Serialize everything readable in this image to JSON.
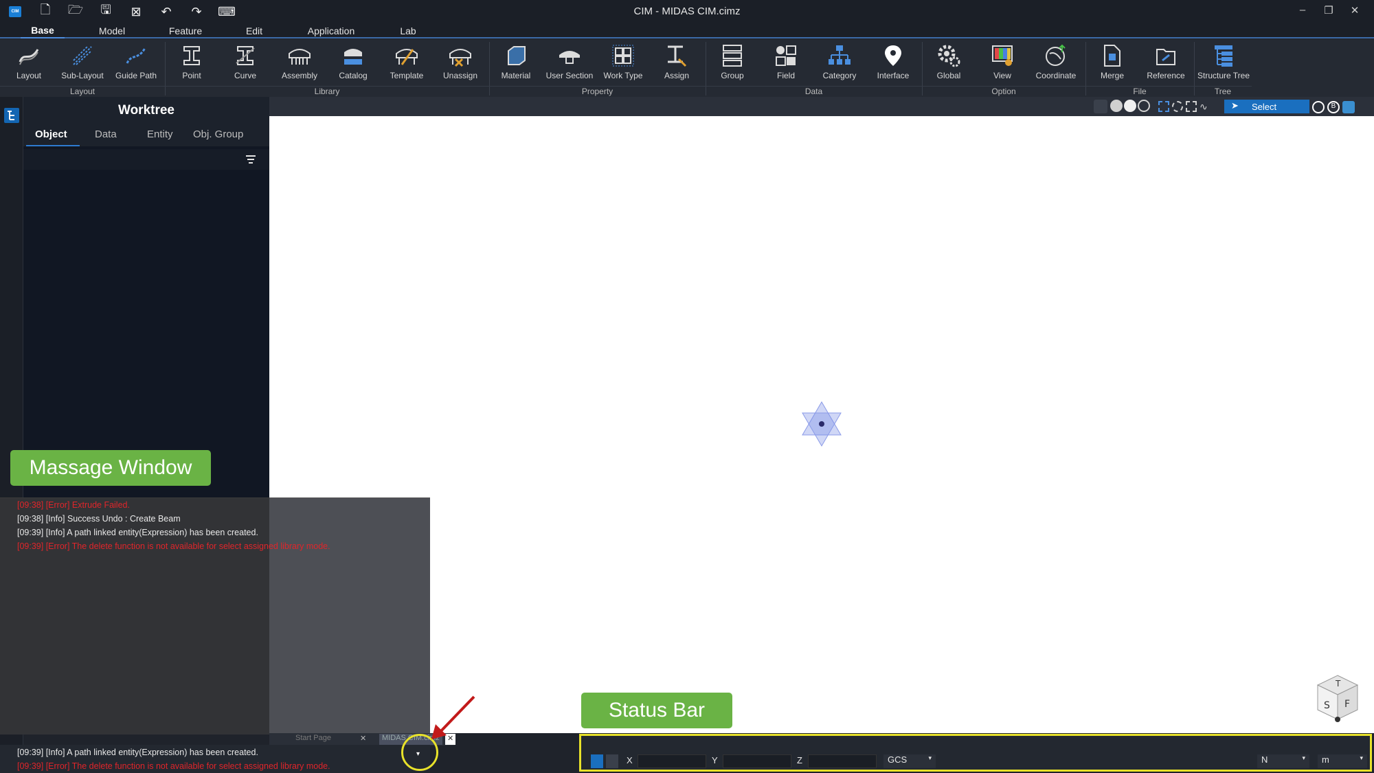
{
  "window": {
    "title": "CIM - MIDAS CIM.cimz",
    "logo_text": "CIM"
  },
  "menu": {
    "tabs": [
      "Base",
      "Model",
      "Feature",
      "Edit",
      "Application",
      "Lab"
    ],
    "active": "Base"
  },
  "ribbon": {
    "buttons": [
      "Layout",
      "Sub-Layout",
      "Guide Path",
      "Point",
      "Curve",
      "Assembly",
      "Catalog",
      "Template",
      "Unassign",
      "Material",
      "User Section",
      "Work Type",
      "Assign",
      "Group",
      "Field",
      "Category",
      "Interface",
      "Global",
      "View",
      "Coordinate",
      "Merge",
      "Reference",
      "Structure Tree"
    ],
    "groups": [
      "Layout",
      "Library",
      "Property",
      "Data",
      "Option",
      "File",
      "Tree"
    ]
  },
  "worktree": {
    "title": "Worktree",
    "tabs": [
      "Object",
      "Data",
      "Entity",
      "Obj. Group"
    ],
    "active_tab": "Object"
  },
  "viewbar": {
    "select_label": "Select"
  },
  "messages": [
    {
      "text": "[09:38] [Error] Extrude Failed.",
      "type": "err"
    },
    {
      "text": "[09:38] [Info] Success Undo : Create Beam",
      "type": "info"
    },
    {
      "text": "[09:39] [Info] A path linked entity(Expression) has been created.",
      "type": "info"
    },
    {
      "text": "[09:39] [Error] The delete function is not available for select assigned library mode.",
      "type": "err"
    }
  ],
  "bottom_messages": [
    {
      "text": "[09:39] [Info] A path linked entity(Expression) has been created.",
      "type": "info"
    },
    {
      "text": "[09:39] [Error] The delete function is not available for select assigned library mode.",
      "type": "err"
    }
  ],
  "doc_tabs": [
    "Start Page",
    "MIDAS CIM.cimz"
  ],
  "statusbar": {
    "x_label": "X",
    "y_label": "Y",
    "z_label": "Z",
    "coord_system": "GCS",
    "force_unit": "N",
    "length_unit": "m"
  },
  "callouts": {
    "message_window": "Massage Window",
    "status_bar": "Status Bar"
  },
  "view_cube": {
    "faces": [
      "T",
      "S",
      "F"
    ]
  },
  "colors": {
    "accent": "#1a6fbf",
    "error": "#e0252a",
    "callout": "#6ab345",
    "highlight": "#e8e22a"
  }
}
